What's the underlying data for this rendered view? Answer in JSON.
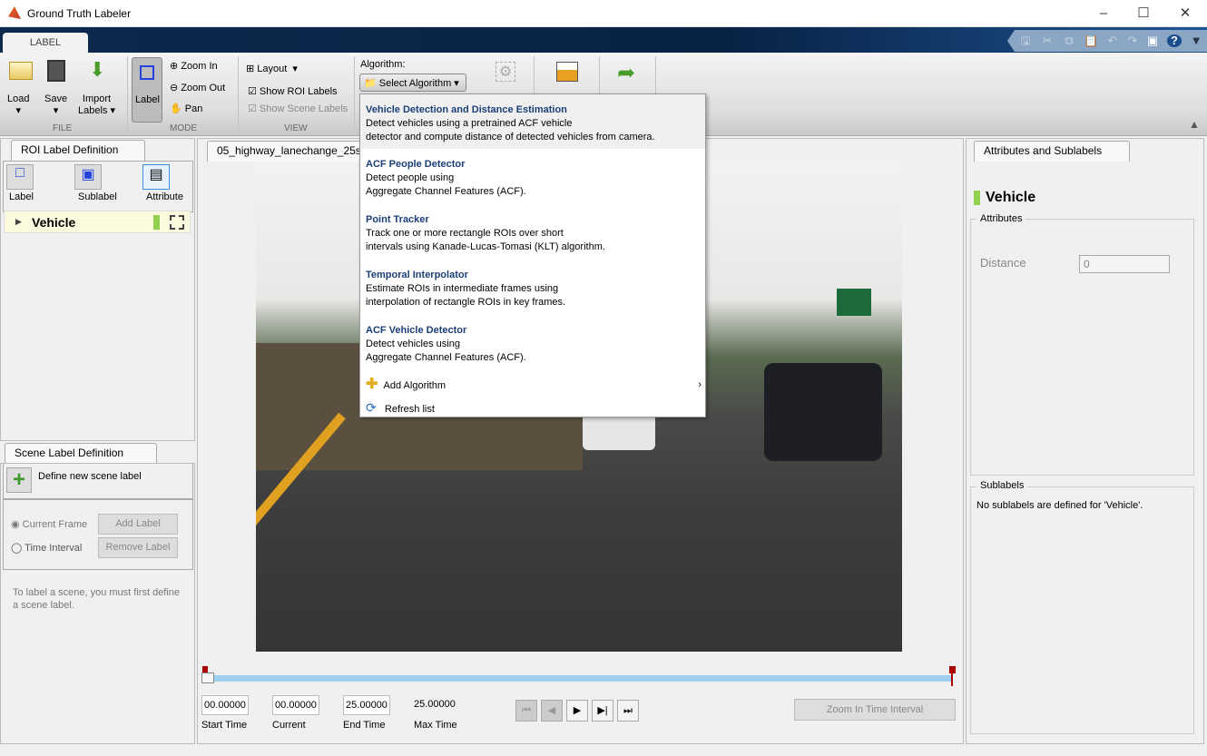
{
  "window": {
    "title": "Ground Truth Labeler"
  },
  "ribbon": {
    "tab": "LABEL",
    "file": {
      "section": "FILE",
      "load": "Load",
      "save": "Save",
      "import": "Import",
      "import2": "Labels"
    },
    "mode": {
      "section": "MODE",
      "label": "Label",
      "zoom_in": "Zoom In",
      "zoom_out": "Zoom Out",
      "pan": "Pan"
    },
    "view": {
      "section": "VIEW",
      "layout": "Layout",
      "show_roi": "Show ROI Labels",
      "show_scene": "Show Scene Labels"
    },
    "algorithm": {
      "label": "Algorithm:",
      "select": "Select Algorithm"
    }
  },
  "dropdown": {
    "items": [
      {
        "title": "Vehicle Detection and Distance Estimation",
        "l1": "Detect vehicles using a pretrained ACF vehicle",
        "l2": "detector and compute distance of detected vehicles from camera."
      },
      {
        "title": "ACF People Detector",
        "l1": "Detect people using",
        "l2": "Aggregate Channel Features (ACF)."
      },
      {
        "title": "Point Tracker",
        "l1": "Track one or more rectangle ROIs over short",
        "l2": "intervals using Kanade-Lucas-Tomasi (KLT) algorithm."
      },
      {
        "title": "Temporal Interpolator",
        "l1": "Estimate ROIs in intermediate frames using",
        "l2": "interpolation of rectangle ROIs in key frames."
      },
      {
        "title": "ACF Vehicle Detector",
        "l1": "Detect vehicles using",
        "l2": "Aggregate Channel Features (ACF)."
      }
    ],
    "add": "Add Algorithm",
    "refresh": "Refresh list"
  },
  "roi": {
    "tab": "ROI Label Definition",
    "label": "Label",
    "sublabel": "Sublabel",
    "attribute": "Attribute",
    "item": "Vehicle",
    "item_color": "#92d050"
  },
  "scene": {
    "tab": "Scene Label Definition",
    "define": "Define new scene label",
    "current_frame": "Current Frame",
    "time_interval": "Time Interval",
    "add": "Add Label",
    "remove": "Remove Label",
    "hint": "To label a scene, you must first define a scene label."
  },
  "video": {
    "tab": "05_highway_lanechange_25s.mp4"
  },
  "timeline": {
    "start": "00.00000",
    "current": "00.00000",
    "end": "25.00000",
    "max": "25.00000",
    "start_lbl": "Start Time",
    "current_lbl": "Current",
    "end_lbl": "End Time",
    "max_lbl": "Max Time",
    "zoom": "Zoom In Time Interval",
    "progress": 0
  },
  "attr": {
    "tab": "Attributes and Sublabels",
    "label": "Vehicle",
    "attributes": "Attributes",
    "distance": "Distance",
    "distance_value": "0",
    "sublabels": "Sublabels",
    "no_sub": "No sublabels are defined for 'Vehicle'."
  }
}
